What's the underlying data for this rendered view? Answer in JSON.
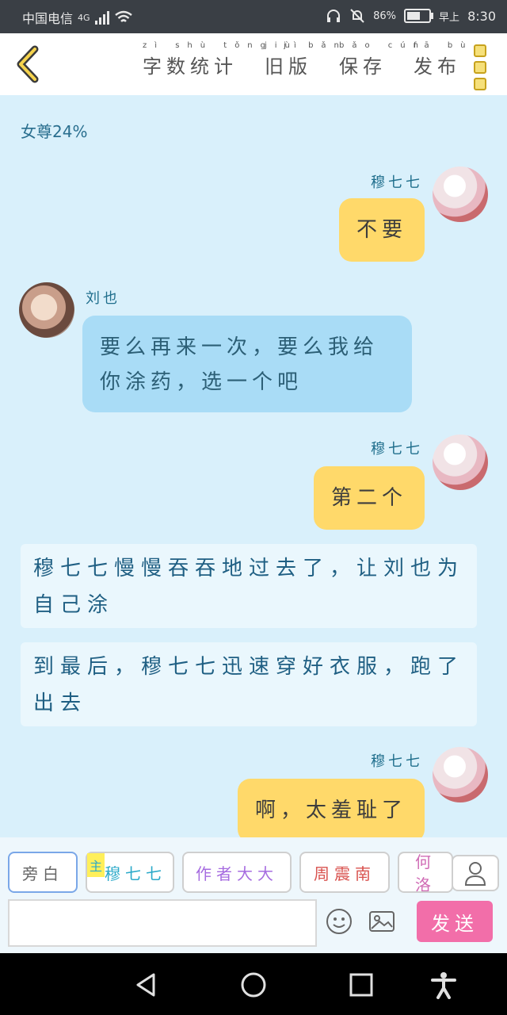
{
  "status_bar": {
    "carrier": "中国电信",
    "network": "4G",
    "battery": "86%",
    "clock_prefix": "早上",
    "time": "8:30"
  },
  "toolbar": {
    "word_count": "字数统计",
    "word_count_pinyin": "zì shù tǒng jì",
    "old_version": "旧版",
    "old_version_pinyin": "jiù bǎn",
    "save": "保存",
    "save_pinyin": "bǎo cún",
    "publish": "发布",
    "publish_pinyin": "fā bù"
  },
  "chat": {
    "top_note": "女尊24%",
    "messages": [
      {
        "speaker": "穆七七",
        "text": "不要",
        "side": "right"
      },
      {
        "speaker": "刘也",
        "text": "要么再来一次，要么我给你涂药，选一个吧",
        "side": "left"
      },
      {
        "speaker": "穆七七",
        "text": "第二个",
        "side": "right"
      },
      {
        "narration": "穆七七慢慢吞吞地过去了，让刘也为自己涂"
      },
      {
        "narration": "到最后，穆七七迅速穿好衣服，跑了出去"
      },
      {
        "speaker": "穆七七",
        "text": "啊，太羞耻了",
        "side": "right"
      }
    ]
  },
  "bottom": {
    "chips": [
      "旁白",
      "穆七七",
      "作者大大",
      "周震南",
      "何洛"
    ],
    "chip_badge": "主",
    "input_value": "",
    "send_label": "发送"
  },
  "colors": {
    "accent_yellow": "#ffd96a",
    "bubble_blue": "#a9dcf6",
    "send_pink": "#f26ea9",
    "chat_bg": "#d9f0fb"
  }
}
